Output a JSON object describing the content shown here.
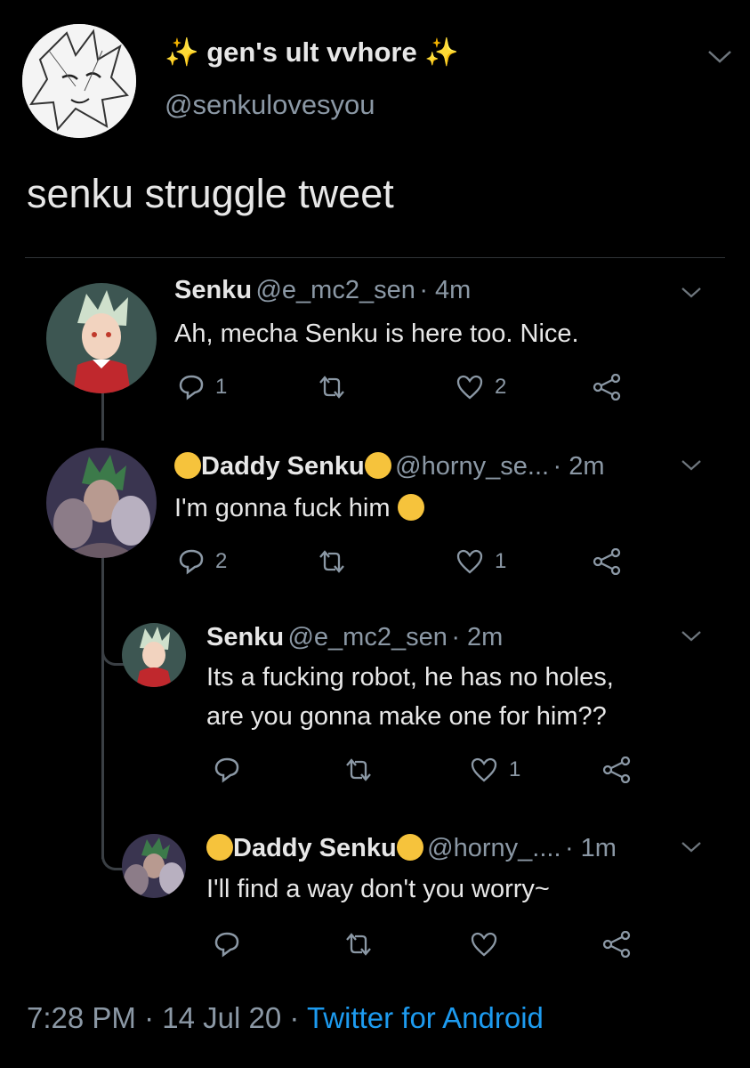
{
  "header": {
    "display_name": "gen's ult vvhore",
    "handle": "@senkulovesyou"
  },
  "tweet": {
    "text": "senku struggle tweet"
  },
  "replies": [
    {
      "name": "Senku",
      "handle": "@e_mc2_sen",
      "time": "· 4m",
      "lines": [
        "Ah, mecha Senku is here too. Nice."
      ],
      "reply_count": "1",
      "retweet_count": "",
      "like_count": "2"
    },
    {
      "name": "Daddy Senku",
      "handle": "@horny_se...",
      "time": "· 2m",
      "lines": [
        "I'm gonna fuck him"
      ],
      "reply_count": "2",
      "retweet_count": "",
      "like_count": "1"
    },
    {
      "name": "Senku",
      "handle": "@e_mc2_sen",
      "time": "· 2m",
      "lines": [
        "Its a fucking robot, he has no holes,",
        "are you gonna make one for him??"
      ],
      "reply_count": "",
      "retweet_count": "",
      "like_count": "1"
    },
    {
      "name": "Daddy Senku",
      "handle": "@horny_....",
      "time": "· 1m",
      "lines": [
        "I'll find a way don't you worry~"
      ],
      "reply_count": "",
      "retweet_count": "",
      "like_count": ""
    }
  ],
  "footer": {
    "time": "7:28 PM",
    "sep1": "·",
    "date": "14 Jul 20",
    "sep2": "·",
    "client": "Twitter for Android"
  },
  "colors": {
    "background": "#000000",
    "text": "#e7e7e7",
    "secondary": "#8b98a5",
    "link": "#1d9bf0"
  }
}
